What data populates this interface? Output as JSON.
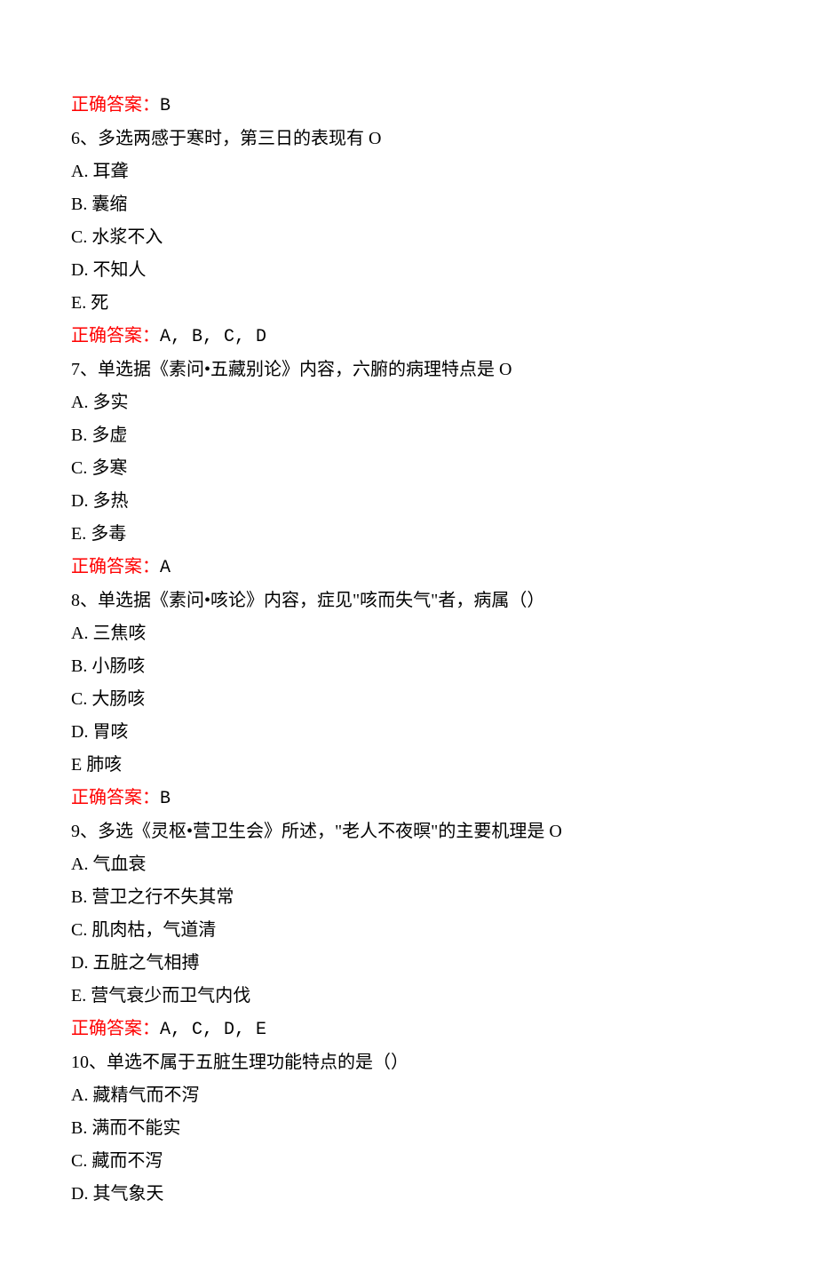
{
  "lines": [
    {
      "answer_label": "正确答案：",
      "answer_value": "B"
    },
    {
      "text": "6、多选两感于寒时，第三日的表现有 O"
    },
    {
      "text": "A. 耳聋"
    },
    {
      "text": "B. 囊缩"
    },
    {
      "text": "C. 水浆不入"
    },
    {
      "text": "D. 不知人"
    },
    {
      "text": "E. 死"
    },
    {
      "answer_label": "正确答案：",
      "answer_value": "A, B, C, D"
    },
    {
      "text": "7、单选据《素问•五藏别论》内容，六腑的病理特点是 O"
    },
    {
      "text": "A. 多实"
    },
    {
      "text": "B. 多虚"
    },
    {
      "text": "C. 多寒"
    },
    {
      "text": "D. 多热"
    },
    {
      "text": "E. 多毒"
    },
    {
      "answer_label": "正确答案：",
      "answer_value": "A"
    },
    {
      "text": "8、单选据《素问•咳论》内容，症见\"咳而失气\"者，病属（）"
    },
    {
      "text": "A. 三焦咳"
    },
    {
      "text": "B. 小肠咳"
    },
    {
      "text": "C. 大肠咳"
    },
    {
      "text": "D. 胃咳"
    },
    {
      "text": "E 肺咳"
    },
    {
      "answer_label": "正确答案：",
      "answer_value": "B"
    },
    {
      "text": "9、多选《灵枢•营卫生会》所述，\"老人不夜暝\"的主要机理是 O"
    },
    {
      "text": "A. 气血衰"
    },
    {
      "text": "B. 营卫之行不失其常"
    },
    {
      "text": "C. 肌肉枯，气道清"
    },
    {
      "text": "D. 五脏之气相搏"
    },
    {
      "text": "E. 营气衰少而卫气内伐"
    },
    {
      "answer_label": "正确答案：",
      "answer_value": "A, C, D, E"
    },
    {
      "text": "10、单选不属于五脏生理功能特点的是（）"
    },
    {
      "text": "A. 藏精气而不泻"
    },
    {
      "text": "B. 满而不能实"
    },
    {
      "text": "C. 藏而不泻"
    },
    {
      "text": "D. 其气象天"
    }
  ]
}
